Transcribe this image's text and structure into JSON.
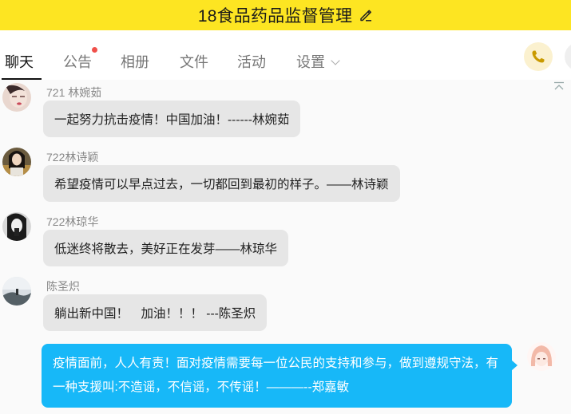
{
  "window": {
    "title": "18食品药品监督管理"
  },
  "tabs": [
    {
      "label": "聊天",
      "active": true
    },
    {
      "label": "公告",
      "badge": true
    },
    {
      "label": "相册"
    },
    {
      "label": "文件"
    },
    {
      "label": "活动"
    },
    {
      "label": "设置"
    }
  ],
  "icons": {
    "edit": "pencil-icon",
    "phone": "phone-icon",
    "collapse": "collapse-icon",
    "dropdown": "chevron-down-icon"
  },
  "colors": {
    "title_bar": "#fde522",
    "self_bubble": "#17b8f8",
    "badge": "#f0504a",
    "phone": "#c99a00"
  },
  "messages": [
    {
      "sender": "721 林婉茹",
      "text": "一起努力抗击疫情！中国加油！------林婉茹"
    },
    {
      "sender": "722林诗颖",
      "text": "希望疫情可以早点过去，一切都回到最初的样子。——林诗颖"
    },
    {
      "sender": "722林琼华",
      "text": "低迷终将散去，美好正在发芽——林琼华"
    },
    {
      "sender": "陈圣炽",
      "text": "躺出新中国！　加油！！！ ---陈圣炽"
    },
    {
      "sender": "",
      "self": true,
      "text": "疫情面前，人人有责！面对疫情需要每一位公民的支持和参与，做到遵规守法，有一种支援叫:不造谣，不信谣，不传谣！———--郑嘉敏"
    }
  ]
}
